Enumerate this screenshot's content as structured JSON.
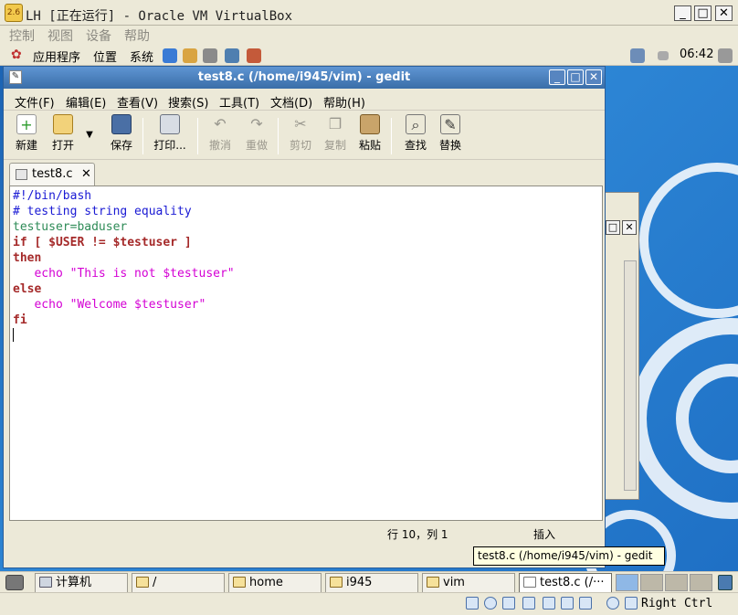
{
  "vbox": {
    "title": "LH [正在运行] - Oracle VM VirtualBox",
    "icon_name": "virtualbox-icon",
    "menu": [
      "控制",
      "视图",
      "设备",
      "帮助"
    ],
    "host_key": "Right Ctrl"
  },
  "guest_panel": {
    "menus": [
      "应用程序",
      "位置",
      "系统"
    ],
    "time": "06:42"
  },
  "gedit": {
    "title": "test8.c (/home/i945/vim) - gedit",
    "menu": [
      "文件(F)",
      "编辑(E)",
      "查看(V)",
      "搜索(S)",
      "工具(T)",
      "文档(D)",
      "帮助(H)"
    ],
    "toolbar": {
      "new": "新建",
      "open": "打开",
      "save": "保存",
      "print": "打印...",
      "undo": "撤消",
      "redo": "重做",
      "cut": "剪切",
      "copy": "复制",
      "paste": "粘贴",
      "find": "查找",
      "replace": "替换"
    },
    "tab_label": "test8.c",
    "code": [
      "#!/bin/bash",
      "# testing string equality",
      "testuser=baduser",
      "if [ $USER != $testuser ]",
      "then",
      "   echo \"This is not $testuser\"",
      "else",
      "   echo \"Welcome $testuser\"",
      "fi"
    ],
    "status_position": "行 10，列 1",
    "status_mode": "插入",
    "tooltip": "test8.c (/home/i945/vim) - gedit"
  },
  "taskbar": {
    "items": [
      "计算机",
      "/",
      "home",
      "i945",
      "vim",
      "test8.c (/···"
    ]
  }
}
